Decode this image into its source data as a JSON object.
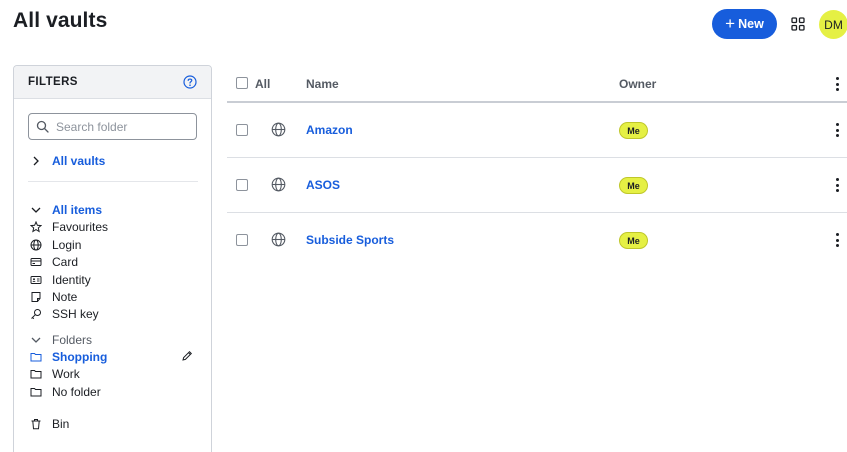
{
  "header": {
    "title": "All vaults",
    "new_button_plus": "+",
    "new_button_label": "New",
    "avatar_initials": "DM"
  },
  "colors": {
    "primary": "#175ddc",
    "avatar": "#e5f044",
    "badge": "#e5f044"
  },
  "filters": {
    "title": "FILTERS",
    "search_placeholder": "Search folder",
    "all_vaults": "All vaults",
    "all_items": "All items",
    "types": [
      {
        "label": "Favourites",
        "icon": "star-icon"
      },
      {
        "label": "Login",
        "icon": "globe-icon"
      },
      {
        "label": "Card",
        "icon": "credit-card-icon"
      },
      {
        "label": "Identity",
        "icon": "id-card-icon"
      },
      {
        "label": "Note",
        "icon": "note-icon"
      },
      {
        "label": "SSH key",
        "icon": "key-icon"
      }
    ],
    "folders_label": "Folders",
    "folders": [
      {
        "label": "Shopping",
        "active": true
      },
      {
        "label": "Work",
        "active": false
      },
      {
        "label": "No folder",
        "active": false
      }
    ],
    "bin": "Bin"
  },
  "table": {
    "col_all": "All",
    "col_name": "Name",
    "col_owner": "Owner",
    "rows": [
      {
        "name": "Amazon",
        "owner": "Me"
      },
      {
        "name": "ASOS",
        "owner": "Me"
      },
      {
        "name": "Subside Sports",
        "owner": "Me"
      }
    ]
  }
}
